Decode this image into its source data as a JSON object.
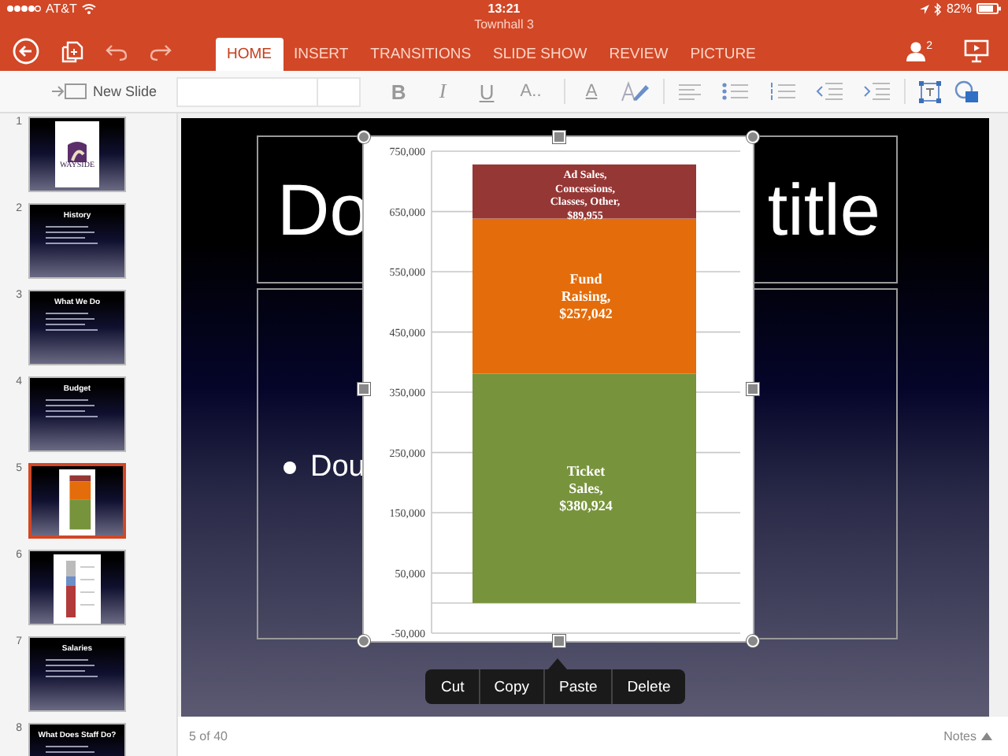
{
  "status_bar": {
    "carrier": "AT&T",
    "time": "13:21",
    "battery_text": "82%"
  },
  "window": {
    "title": "Townhall 3"
  },
  "tabs": [
    {
      "label": "HOME",
      "selected": true
    },
    {
      "label": "INSERT",
      "selected": false
    },
    {
      "label": "TRANSITIONS",
      "selected": false
    },
    {
      "label": "SLIDE SHOW",
      "selected": false
    },
    {
      "label": "REVIEW",
      "selected": false
    },
    {
      "label": "PICTURE",
      "selected": false
    }
  ],
  "share_count": "2",
  "ribbon": {
    "new_slide": "New Slide",
    "format_buttons": [
      "B",
      "I",
      "U",
      "A.."
    ],
    "font_color": "A"
  },
  "slides": [
    {
      "number": "1",
      "kind": "logo",
      "title": "WAYSIDE",
      "selected": false
    },
    {
      "number": "2",
      "kind": "text",
      "title": "History",
      "selected": false
    },
    {
      "number": "3",
      "kind": "text",
      "title": "What We Do",
      "selected": false
    },
    {
      "number": "4",
      "kind": "text",
      "title": "Budget",
      "selected": false
    },
    {
      "number": "5",
      "kind": "stacked-chart",
      "selected": true
    },
    {
      "number": "6",
      "kind": "bar-chart",
      "selected": false
    },
    {
      "number": "7",
      "kind": "text",
      "title": "Salaries",
      "selected": false
    },
    {
      "number": "8",
      "kind": "text",
      "title": "What Does Staff Do?",
      "selected": false
    }
  ],
  "slide": {
    "title_parts": [
      "Do",
      "title"
    ],
    "bullet": "Dou",
    "chart": {
      "chart_data": {
        "type": "bar",
        "stacked": true,
        "grid": true,
        "ylim": [
          -50000,
          750000
        ],
        "yticks": [
          {
            "value": -50000,
            "label": "-50,000"
          },
          {
            "value": 50000,
            "label": "50,000"
          },
          {
            "value": 150000,
            "label": "150,000"
          },
          {
            "value": 250000,
            "label": "250,000"
          },
          {
            "value": 350000,
            "label": "350,000"
          },
          {
            "value": 450000,
            "label": "450,000"
          },
          {
            "value": 550000,
            "label": "550,000"
          },
          {
            "value": 650000,
            "label": "650,000"
          },
          {
            "value": 750000,
            "label": "750,000"
          }
        ],
        "series": [
          {
            "name": "Ticket Sales,",
            "color": "#77933c",
            "values": [
              380924
            ]
          },
          {
            "name": "Fund Raising,",
            "color": "#e46c0a",
            "values": [
              257042
            ]
          },
          {
            "name": "Ad Sales, Concessions, Classes, Other,",
            "color": "#953735",
            "values": [
              89955
            ]
          }
        ],
        "value_labels": [
          "$380,924",
          "$257,042",
          "$89,955"
        ]
      }
    },
    "context_menu": [
      "Cut",
      "Copy",
      "Paste",
      "Delete"
    ]
  },
  "footer": {
    "position": "5 of 40",
    "notes": "Notes"
  }
}
